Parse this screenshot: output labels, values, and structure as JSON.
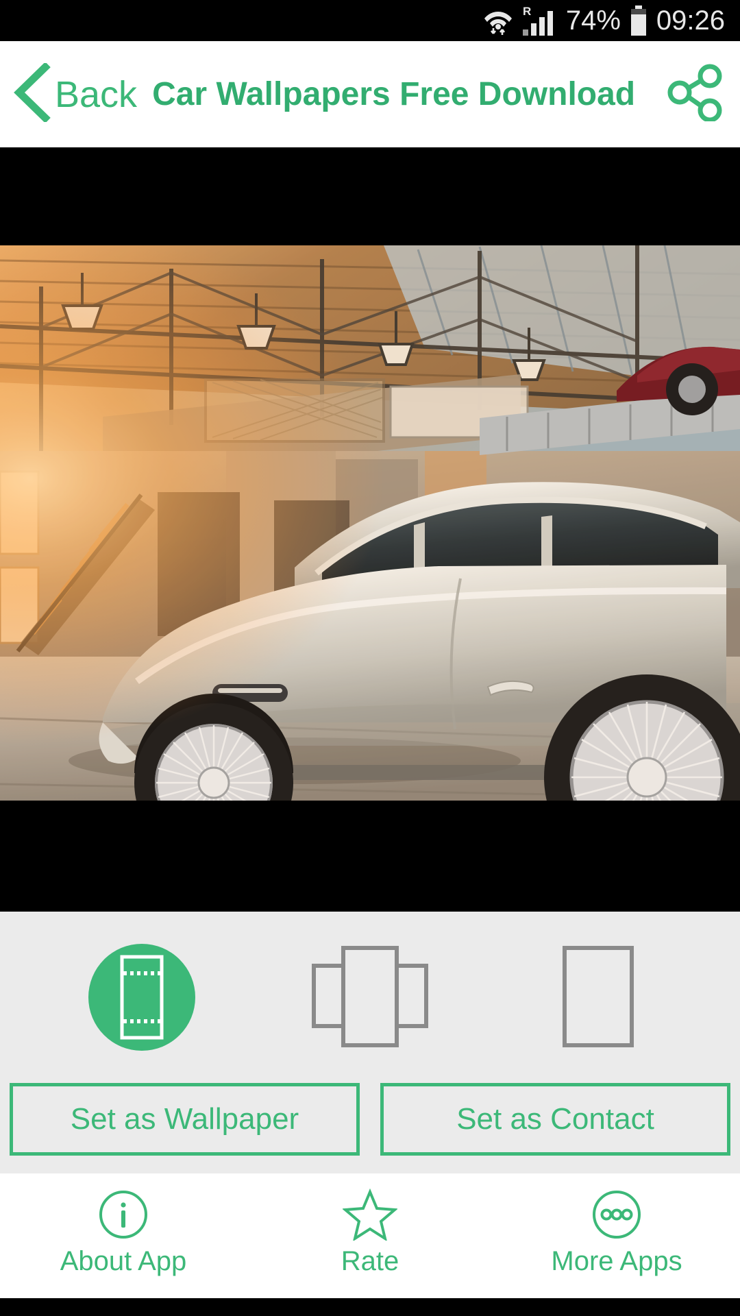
{
  "statusbar": {
    "wifi_icon": "wifi-icon",
    "roaming_icon": "roaming-signal-icon",
    "roaming_letter": "R",
    "battery_percent": "74%",
    "battery_icon": "battery-icon",
    "clock": "09:26"
  },
  "header": {
    "back_icon": "chevron-left-icon",
    "back_label": "Back",
    "title": "Car Wallpapers Free Download",
    "share_icon": "share-icon"
  },
  "photo": {
    "alt": "Classic silver sports car in an industrial warehouse at sunset"
  },
  "panel": {
    "modes": [
      {
        "name": "mode-crop-fit",
        "icon": "crop-fit-icon",
        "selected": true
      },
      {
        "name": "mode-scroll",
        "icon": "scroll-panels-icon",
        "selected": false
      },
      {
        "name": "mode-single",
        "icon": "single-screen-icon",
        "selected": false
      }
    ],
    "set_wallpaper_label": "Set as Wallpaper",
    "set_contact_label": "Set as Contact"
  },
  "bottomnav": {
    "items": [
      {
        "name": "about-app",
        "icon": "info-circle-icon",
        "label": "About App"
      },
      {
        "name": "rate",
        "icon": "star-outline-icon",
        "label": "Rate"
      },
      {
        "name": "more-apps",
        "icon": "more-circle-icon",
        "label": "More Apps"
      }
    ]
  },
  "colors": {
    "accent": "#3cb878",
    "title_green": "#32ad70",
    "panel_bg": "#ebebeb",
    "mode_outline": "#8a8a8a",
    "status_text": "#e8e8e8"
  }
}
